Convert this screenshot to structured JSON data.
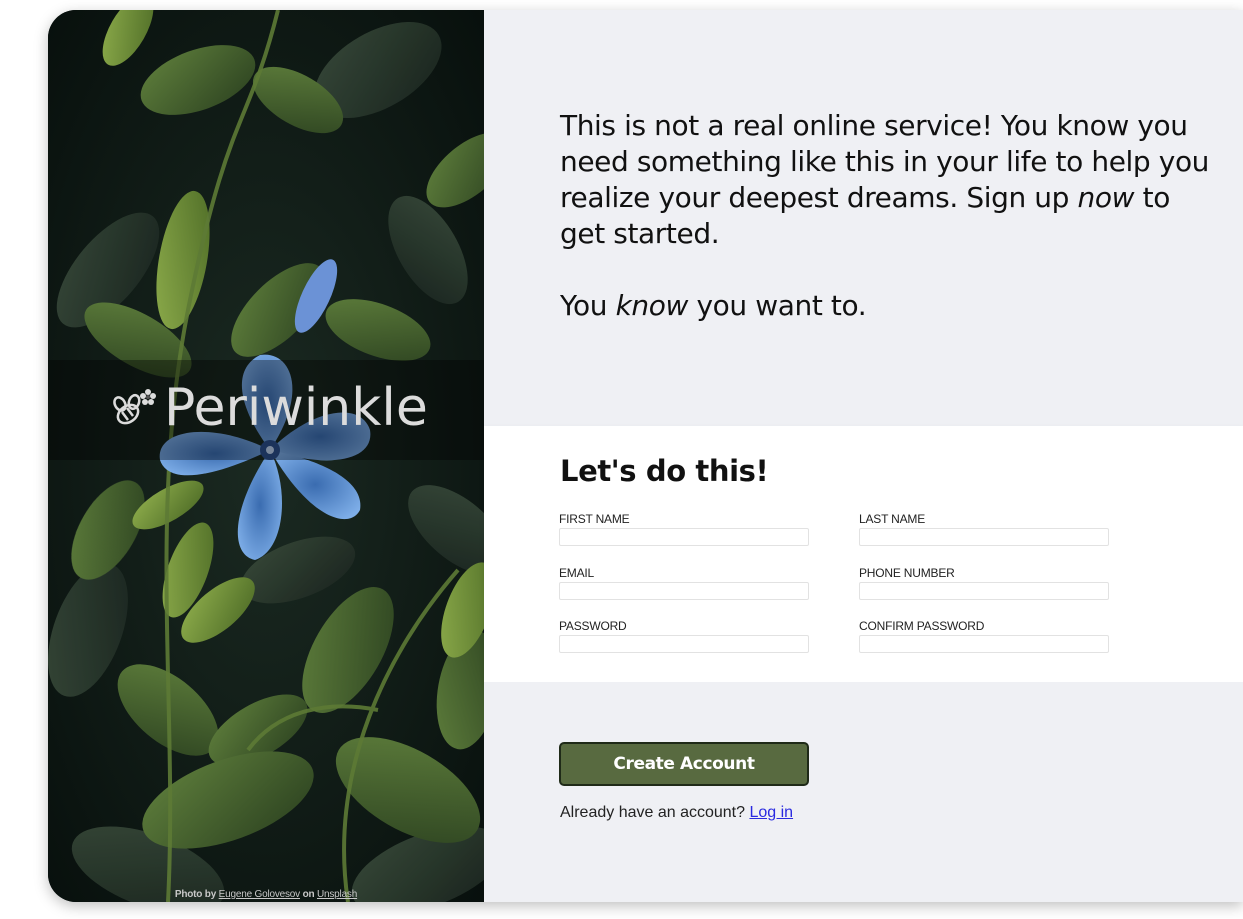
{
  "brand": {
    "name": "Periwinkle",
    "logo_icon": "flower-bee-icon"
  },
  "photo_credit": {
    "prefix": "Photo by",
    "author": "Eugene Golovesov",
    "middle": "on",
    "source": "Unsplash"
  },
  "intro": {
    "paragraph1_part1": "This is not a real online service! You know you need something like this in your life to help you realize your deepest dreams. Sign up ",
    "paragraph1_emph": "now",
    "paragraph1_part2": " to get started.",
    "paragraph2_part1": "You ",
    "paragraph2_emph": "know",
    "paragraph2_part2": " you want to."
  },
  "form": {
    "title": "Let's do this!",
    "fields": {
      "first_name": {
        "label": "First Name",
        "value": ""
      },
      "last_name": {
        "label": "Last Name",
        "value": ""
      },
      "email": {
        "label": "Email",
        "value": ""
      },
      "phone": {
        "label": "Phone Number",
        "value": ""
      },
      "password": {
        "label": "Password",
        "value": ""
      },
      "confirm_password": {
        "label": "Confirm Password",
        "value": ""
      }
    }
  },
  "actions": {
    "create_label": "Create Account",
    "login_prompt": "Already have an account?",
    "login_link": "Log in"
  },
  "colors": {
    "accent_button": "#586a40",
    "panel_bg": "#eff0f4",
    "flower": "#6fa0e0",
    "link": "#2a2ae0"
  }
}
